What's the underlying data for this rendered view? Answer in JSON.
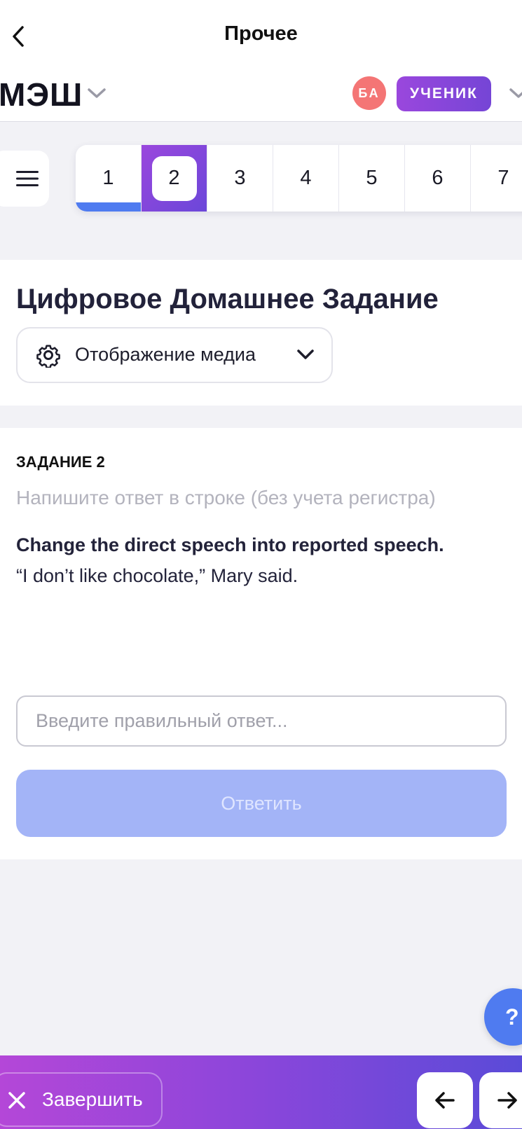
{
  "header": {
    "title": "Прочее"
  },
  "brandbar": {
    "logo": "МЭШ",
    "avatar_initials": "БА",
    "role": "УЧЕНИК"
  },
  "question_nav": {
    "items": [
      "1",
      "2",
      "3",
      "4",
      "5",
      "6",
      "7"
    ],
    "active": "2",
    "completed": [
      "1"
    ],
    "accent": "#4f7bf0"
  },
  "homework": {
    "title": "Цифровое Домашнее Задание",
    "media_label": "Отображение медиа"
  },
  "task": {
    "number_label": "ЗАДАНИЕ 2",
    "hint": "Напишите ответ в строке (без учета регистра)",
    "instruction": "Change the direct speech into reported speech.",
    "sentence": "“I don’t like chocolate,” Mary said.",
    "answer_placeholder": "Введите правильный ответ...",
    "answer_value": "",
    "submit_label": "Ответить"
  },
  "help": {
    "label": "?"
  },
  "footer": {
    "finish_label": "Завершить"
  },
  "icons": {
    "back": "chevron-left-icon",
    "menu": "hamburger-icon",
    "media": "gear-icon",
    "finish": "close-icon",
    "prev": "arrow-left-icon",
    "next": "arrow-right-icon"
  },
  "colors": {
    "brand_gradient_start": "#9a47dd",
    "brand_gradient_end": "#6b47d9",
    "primary_blue": "#4f7bf0",
    "disabled_button": "#a3b4f7",
    "avatar": "#f47575"
  }
}
